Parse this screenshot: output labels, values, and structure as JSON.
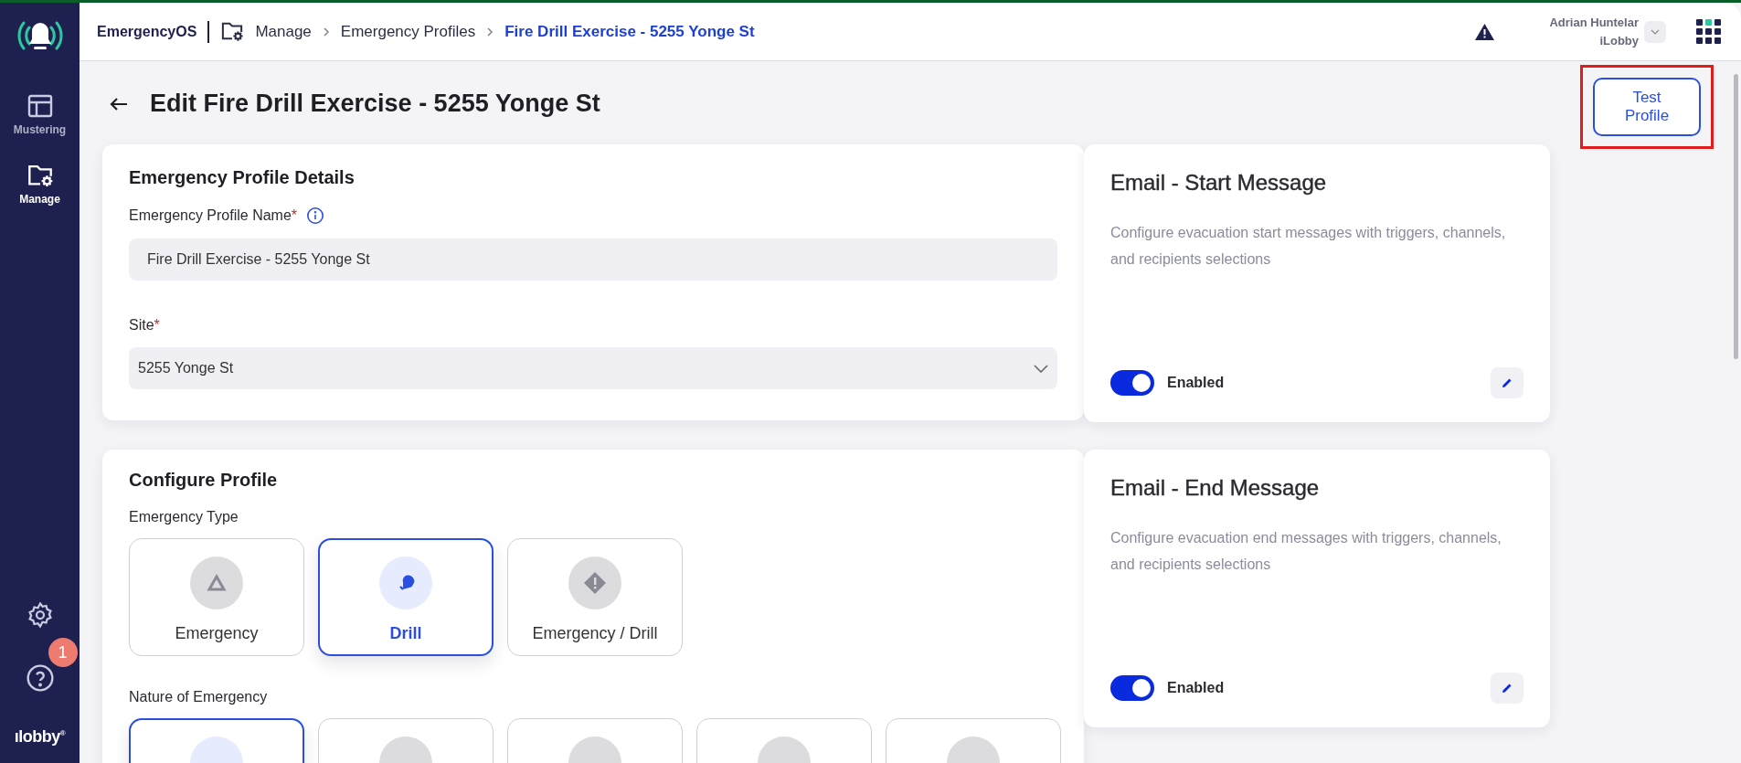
{
  "sidebar": {
    "items": [
      {
        "label": "Mustering",
        "selected": false
      },
      {
        "label": "Manage",
        "selected": true
      }
    ],
    "help_badge": "1",
    "logo_text": "ılobby",
    "logo_mark": "®"
  },
  "topbar": {
    "app_name": "EmergencyOS",
    "breadcrumbs": [
      {
        "label": "Manage",
        "current": false
      },
      {
        "label": "Emergency Profiles",
        "current": false
      },
      {
        "label": "Fire Drill Exercise - 5255 Yonge St",
        "current": true
      }
    ],
    "user": {
      "name": "Adrian Huntelar",
      "org": "iLobby"
    }
  },
  "page": {
    "title": "Edit Fire Drill Exercise - 5255 Yonge St",
    "test_button": {
      "label": "Test Profile",
      "highlighted": true
    }
  },
  "details": {
    "title": "Emergency Profile Details",
    "fields": [
      {
        "kind": "text",
        "label": "Emergency Profile Name",
        "required_mark": "*",
        "info": true,
        "value": "Fire Drill Exercise - 5255 Yonge St"
      },
      {
        "kind": "select",
        "label": "Site",
        "required_mark": "*",
        "info": false,
        "value": "5255 Yonge St"
      }
    ]
  },
  "configure": {
    "title": "Configure Profile",
    "emergency_type": {
      "label": "Emergency Type",
      "options": [
        {
          "label": "Emergency",
          "selected": false
        },
        {
          "label": "Drill",
          "selected": true
        },
        {
          "label": "Emergency / Drill",
          "selected": false
        }
      ]
    },
    "nature": {
      "label": "Nature of Emergency",
      "options": [
        {
          "selected": true
        },
        {
          "selected": false
        },
        {
          "selected": false
        },
        {
          "selected": false
        },
        {
          "selected": false
        }
      ]
    }
  },
  "message_cards": [
    {
      "title": "Email - Start Message",
      "description": "Configure evacuation start messages with triggers, channels, and recipients selections",
      "enabled": true,
      "toggle_label": "Enabled"
    },
    {
      "title": "Email - End Message",
      "description": "Configure evacuation end messages with triggers, channels, and recipients selections",
      "enabled": true,
      "toggle_label": "Enabled"
    }
  ]
}
